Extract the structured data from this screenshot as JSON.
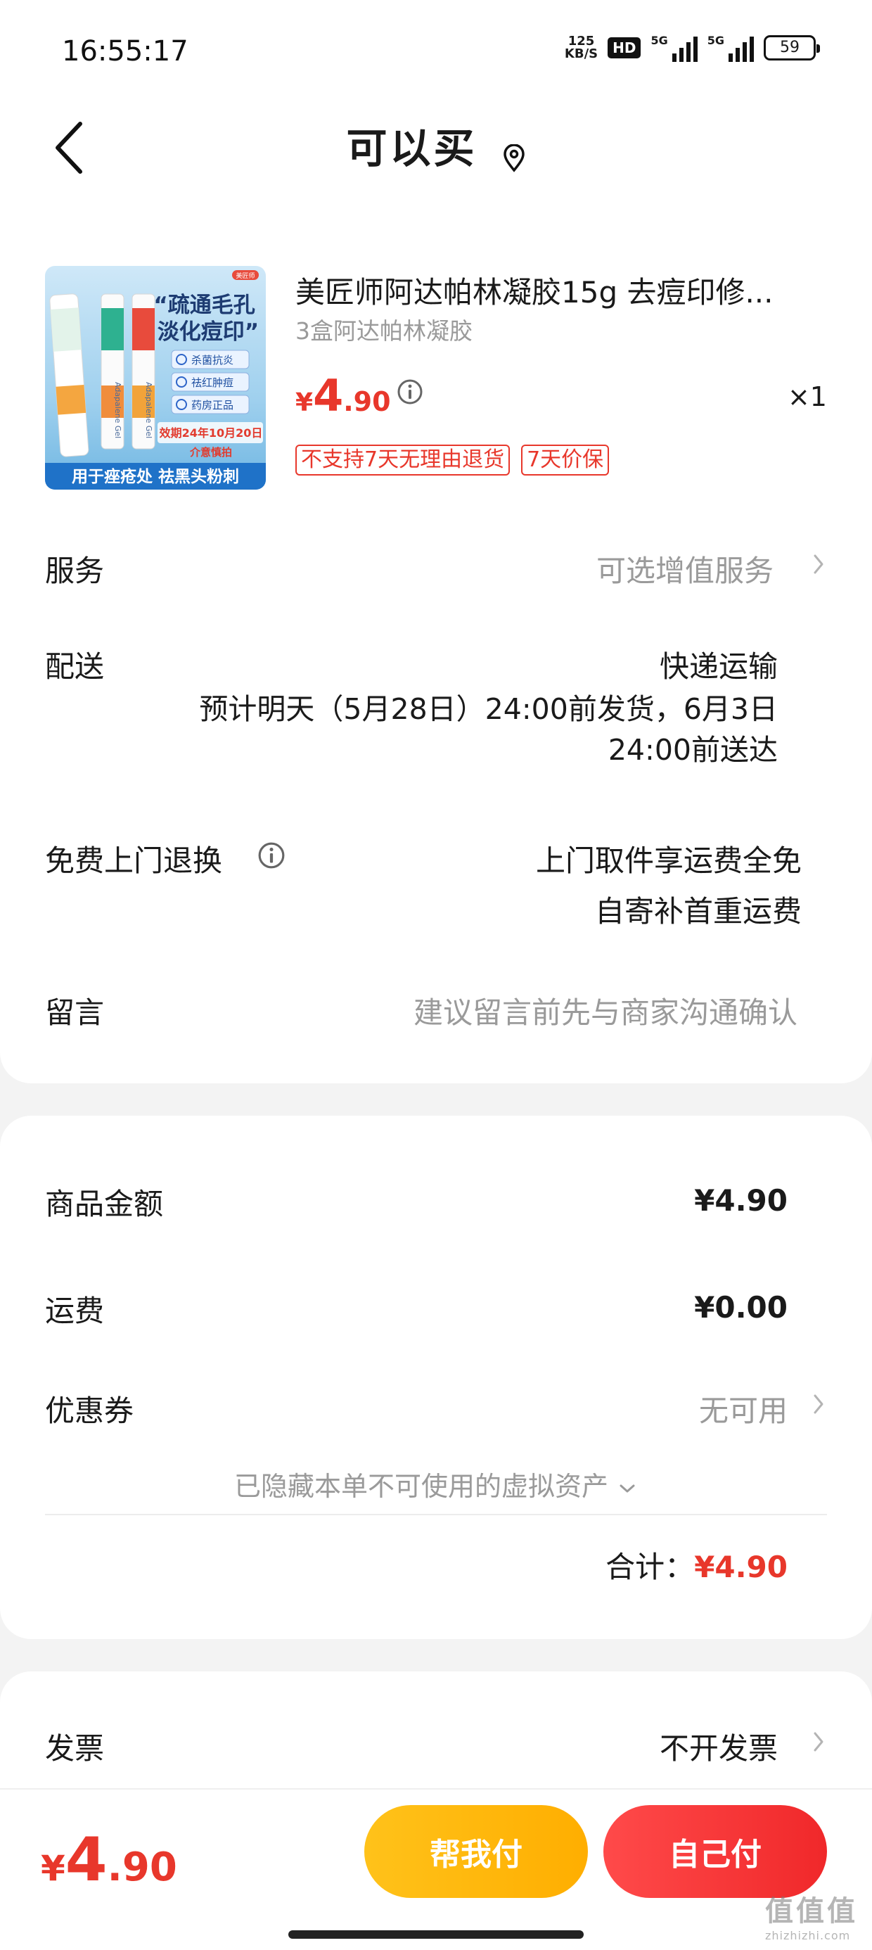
{
  "status_bar": {
    "time": "16:55:17",
    "net_speed_value": "125",
    "net_speed_unit": "KB/S",
    "hd": "HD",
    "sim1": "5G",
    "sim2": "5G",
    "battery": "59"
  },
  "header": {
    "title": "可以买"
  },
  "product": {
    "name": "美匠师阿达帕林凝胶15g 去痘印修...",
    "sku": "3盒阿达帕林凝胶",
    "price_currency": "¥",
    "price_int": "4",
    "price_dec": ".90",
    "quantity": "×1",
    "tags": [
      "不支持7天无理由退货",
      "7天价保"
    ],
    "image": {
      "brand": "美匠师",
      "headline": "“疏通毛孔\n淡化痘印”",
      "features": [
        "杀菌抗炎",
        "祛红肿痘",
        "药房正品"
      ],
      "expiry": "效期24年10月20日",
      "caution": "介意慎拍",
      "tube_label": "Adapalene Gel",
      "banner": "用于痤疮处 祛黑头粉刺"
    }
  },
  "service": {
    "label": "服务",
    "value": "可选增值服务"
  },
  "delivery": {
    "label": "配送",
    "method": "快递运输",
    "estimate_line1": "预计明天（5月28日）24:00前发货，6月3日",
    "estimate_line2": "24:00前送达"
  },
  "return": {
    "label": "免费上门退换",
    "line1": "上门取件享运费全免",
    "line2": "自寄补首重运费"
  },
  "message": {
    "label": "留言",
    "placeholder": "建议留言前先与商家沟通确认"
  },
  "summary": {
    "goods_label": "商品金额",
    "goods_value": "¥4.90",
    "shipping_label": "运费",
    "shipping_value": "¥0.00",
    "coupon_label": "优惠券",
    "coupon_value": "无可用",
    "hidden_assets": "已隐藏本单不可使用的虚拟资产",
    "total_label": "合计：",
    "total_value": "¥4.90"
  },
  "invoice": {
    "label": "发票",
    "value": "不开发票"
  },
  "bottom": {
    "price_currency": "¥",
    "price_int": "4",
    "price_dec": ".90",
    "help_pay": "帮我付",
    "self_pay": "自己付"
  },
  "watermark": {
    "logo": "值值值",
    "site": "zhizhizhi.com"
  },
  "colors": {
    "accent_red": "#e8372b",
    "help_yellow": "#ffb80e",
    "self_red": "#f0282a",
    "tag_red": "#e8372b"
  }
}
